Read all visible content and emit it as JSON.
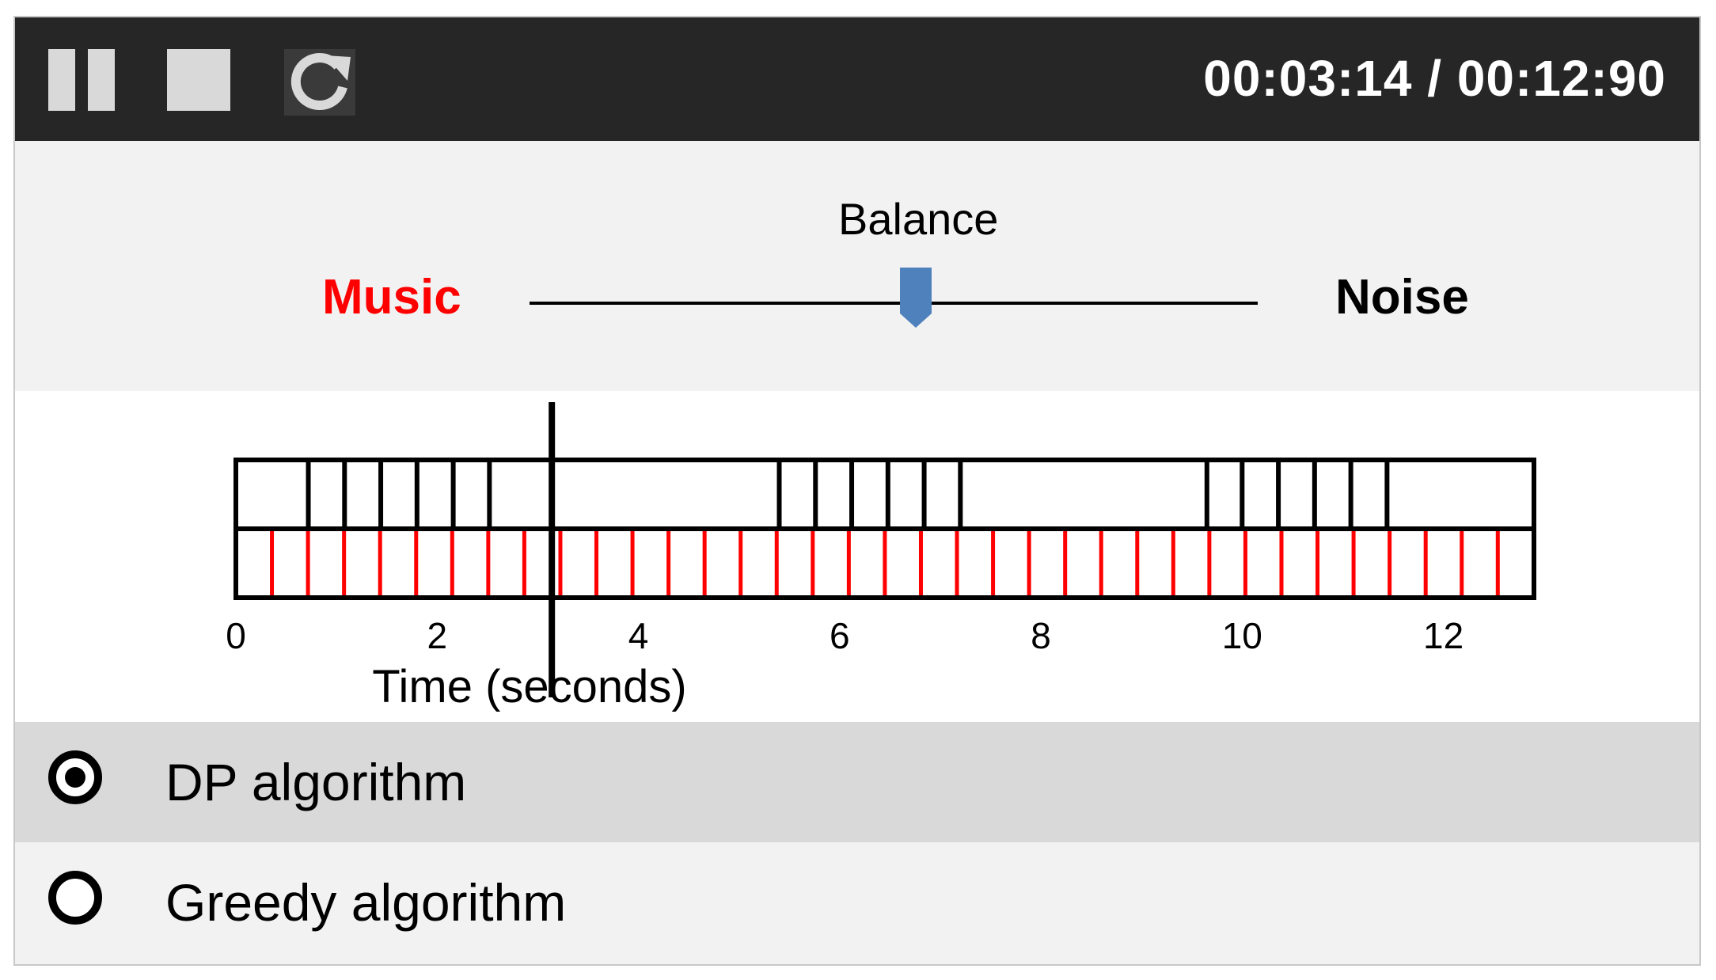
{
  "toolbar": {
    "pause_icon": "pause-icon",
    "stop_icon": "stop-icon",
    "reload_icon": "reload-icon",
    "time_readout": "00:03:14 / 00:12:90"
  },
  "balance": {
    "title": "Balance",
    "left_label": "Music",
    "right_label": "Noise",
    "value": 0.53,
    "colors": {
      "music": "#ff0000",
      "thumb": "#4f81bd"
    }
  },
  "timeline": {
    "x_axis_label": "Time (seconds)",
    "xlim": [
      0,
      12.9
    ],
    "ticks": [
      "0",
      "2",
      "4",
      "6",
      "8",
      "10",
      "12"
    ],
    "tick_values": [
      0,
      2,
      4,
      6,
      8,
      10,
      12
    ],
    "playhead_time": 3.14,
    "noise_event_times": [
      0.72,
      1.08,
      1.44,
      1.8,
      2.16,
      2.52,
      5.4,
      5.76,
      6.12,
      6.48,
      6.84,
      7.2,
      9.65,
      10.0,
      10.36,
      10.72,
      11.08,
      11.44
    ],
    "music_beat_interval": 0.3583,
    "colors": {
      "music": "#ff0000",
      "noise": "#000000"
    }
  },
  "options": {
    "items": [
      {
        "label": "DP algorithm",
        "selected": true
      },
      {
        "label": "Greedy algorithm",
        "selected": false
      }
    ]
  }
}
